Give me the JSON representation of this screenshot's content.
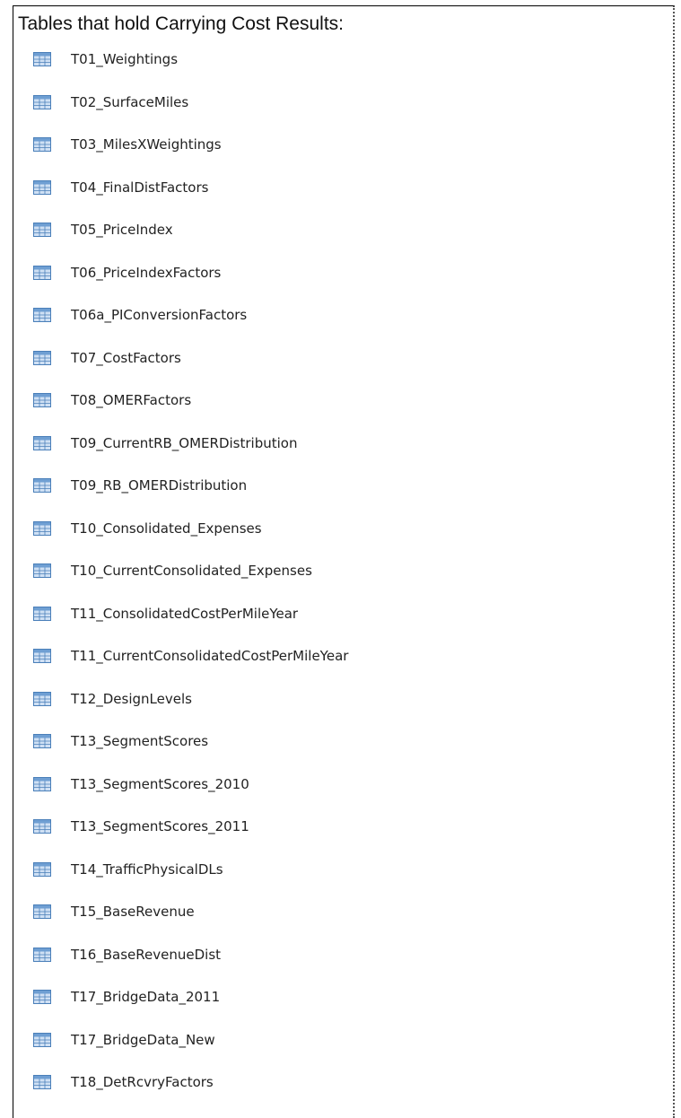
{
  "heading": "Tables that hold Carrying Cost Results:",
  "icon": "table-icon",
  "colors": {
    "icon_fill": "#cfe0f4",
    "icon_header": "#6f9fd3",
    "icon_border": "#4a7fb9"
  },
  "tables": [
    "T01_Weightings",
    "T02_SurfaceMiles",
    "T03_MilesXWeightings",
    "T04_FinalDistFactors",
    "T05_PriceIndex",
    "T06_PriceIndexFactors",
    "T06a_PIConversionFactors",
    "T07_CostFactors",
    "T08_OMERFactors",
    "T09_CurrentRB_OMERDistribution",
    "T09_RB_OMERDistribution",
    "T10_Consolidated_Expenses",
    "T10_CurrentConsolidated_Expenses",
    "T11_ConsolidatedCostPerMileYear",
    "T11_CurrentConsolidatedCostPerMileYear",
    "T12_DesignLevels",
    "T13_SegmentScores",
    "T13_SegmentScores_2010",
    "T13_SegmentScores_2011",
    "T14_TrafficPhysicalDLs",
    "T15_BaseRevenue",
    "T16_BaseRevenueDist",
    "T17_BridgeData_2011",
    "T17_BridgeData_New",
    "T18_DetRcvryFactors"
  ]
}
